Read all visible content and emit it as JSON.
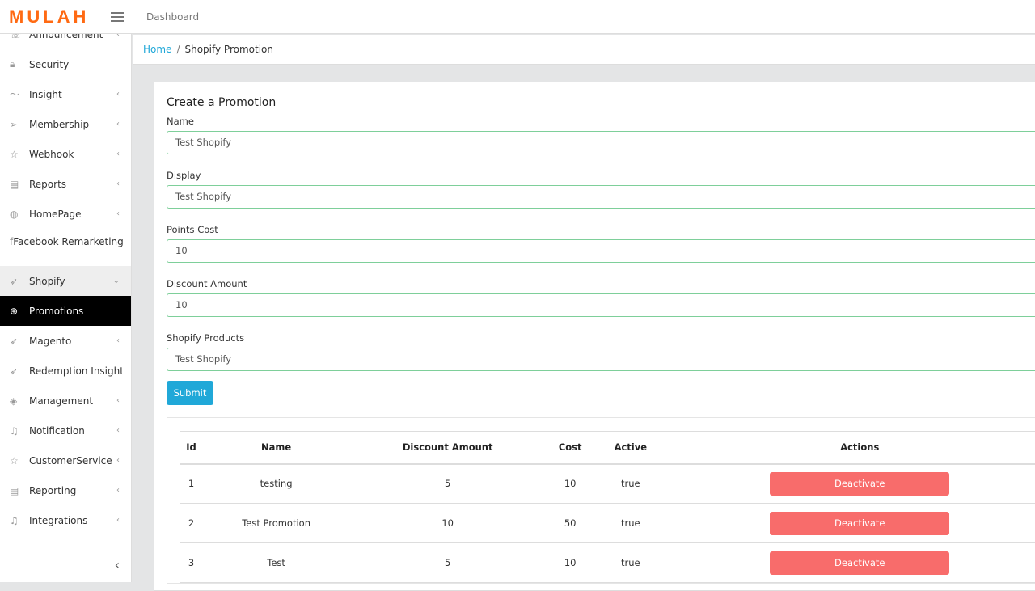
{
  "header": {
    "logo": "MULAH",
    "nav": "Dashboard"
  },
  "sidebar": {
    "items": [
      {
        "label": "Announcement",
        "icon": "megaphone-icon",
        "chev": true
      },
      {
        "label": "Security",
        "icon": "lock-icon",
        "chev": false
      },
      {
        "label": "Insight",
        "icon": "chart-line-icon",
        "chev": true
      },
      {
        "label": "Membership",
        "icon": "paper-plane-icon",
        "chev": true
      },
      {
        "label": "Webhook",
        "icon": "star-icon",
        "chev": true
      },
      {
        "label": "Reports",
        "icon": "book-icon",
        "chev": true
      },
      {
        "label": "HomePage",
        "icon": "globe-icon",
        "chev": true
      },
      {
        "label": "Facebook Remarketing",
        "icon": "facebook-icon",
        "chev": false
      },
      {
        "label": "Shopify",
        "icon": "rocket-icon",
        "chev": true,
        "open": true
      },
      {
        "label": "Promotions",
        "icon": "plus-circle-icon",
        "chev": false,
        "active": true
      },
      {
        "label": "Magento",
        "icon": "rocket-icon",
        "chev": true
      },
      {
        "label": "Redemption Insight",
        "icon": "rocket-icon",
        "chev": false
      },
      {
        "label": "Management",
        "icon": "layers-icon",
        "chev": true
      },
      {
        "label": "Notification",
        "icon": "bell-icon",
        "chev": true
      },
      {
        "label": "CustomerService",
        "icon": "star-icon",
        "chev": true
      },
      {
        "label": "Reporting",
        "icon": "book-icon",
        "chev": true
      },
      {
        "label": "Integrations",
        "icon": "bell-icon",
        "chev": true
      }
    ]
  },
  "breadcrumb": {
    "home": "Home",
    "current": "Shopify Promotion"
  },
  "form": {
    "title": "Create a Promotion",
    "fields": [
      {
        "label": "Name",
        "value": "Test Shopify"
      },
      {
        "label": "Display",
        "value": "Test Shopify"
      },
      {
        "label": "Points Cost",
        "value": "10"
      },
      {
        "label": "Discount Amount",
        "value": "10"
      },
      {
        "label": "Shopify Products",
        "value": "Test Shopify"
      }
    ],
    "submit": "Submit"
  },
  "table": {
    "headers": [
      "Id",
      "Name",
      "Discount Amount",
      "Cost",
      "Active",
      "Actions"
    ],
    "rows": [
      {
        "id": "1",
        "name": "testing",
        "discount": "5",
        "cost": "10",
        "active": "true",
        "action": "Deactivate"
      },
      {
        "id": "2",
        "name": "Test Promotion",
        "discount": "10",
        "cost": "50",
        "active": "true",
        "action": "Deactivate"
      },
      {
        "id": "3",
        "name": "Test",
        "discount": "5",
        "cost": "10",
        "active": "true",
        "action": "Deactivate"
      }
    ]
  },
  "colors": {
    "brand": "#ff6a13",
    "primary": "#20a8d8",
    "danger": "#f86c6b",
    "active_bg": "#000000"
  }
}
